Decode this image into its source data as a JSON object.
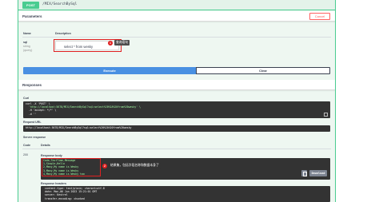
{
  "operation": {
    "method": "POST",
    "path": "/MIX/SearchBySql"
  },
  "parameters": {
    "title": "Parameters",
    "cancel_label": "Cancel",
    "col_name": "Name",
    "col_description": "Description",
    "param_name": "sql",
    "param_type": "string",
    "param_in": "(query)",
    "input_value": "select * from wesky",
    "annotation_number": "1",
    "annotation_text": "查询语句"
  },
  "actions": {
    "execute_label": "Execute",
    "clear_label": "Clear"
  },
  "responses": {
    "title": "Responses",
    "curl_label": "Curl",
    "curl_lines": [
      "curl -X 'POST' \\",
      "  'http://localhost:5678/MIX/SearchBySql?sql=select%20%2A%20from%20wesky' \\",
      "  -H 'accept: */*' \\",
      "  -d ''"
    ],
    "request_url_label": "Request URL",
    "request_url": "http://localhost:5678/MIX/SearchBySql?sql=select%20%2A%20from%20wesky",
    "server_response_label": "Server response",
    "code_header": "Code",
    "details_header": "Details",
    "code": "200",
    "body_label": "Response body",
    "body_lines": [
      "Code,TestTime,Message",
      "1,Simple,Hello",
      "2,Many,My name is Wesky",
      "3,Many,My name is Wesky",
      "4,Many,My name is Wesky too"
    ],
    "annotation_number": "2",
    "annotation_text": "结果集，包括字段名称和数据本身了",
    "download_label": "Download",
    "headers_label": "Response headers",
    "header_lines": [
      " content-type: text/plain; charset=utf-8",
      " date: Mon,06 Jun 2023 15:21:01 GMT",
      " server: Kestrel",
      " transfer-encoding: chunked"
    ]
  }
}
